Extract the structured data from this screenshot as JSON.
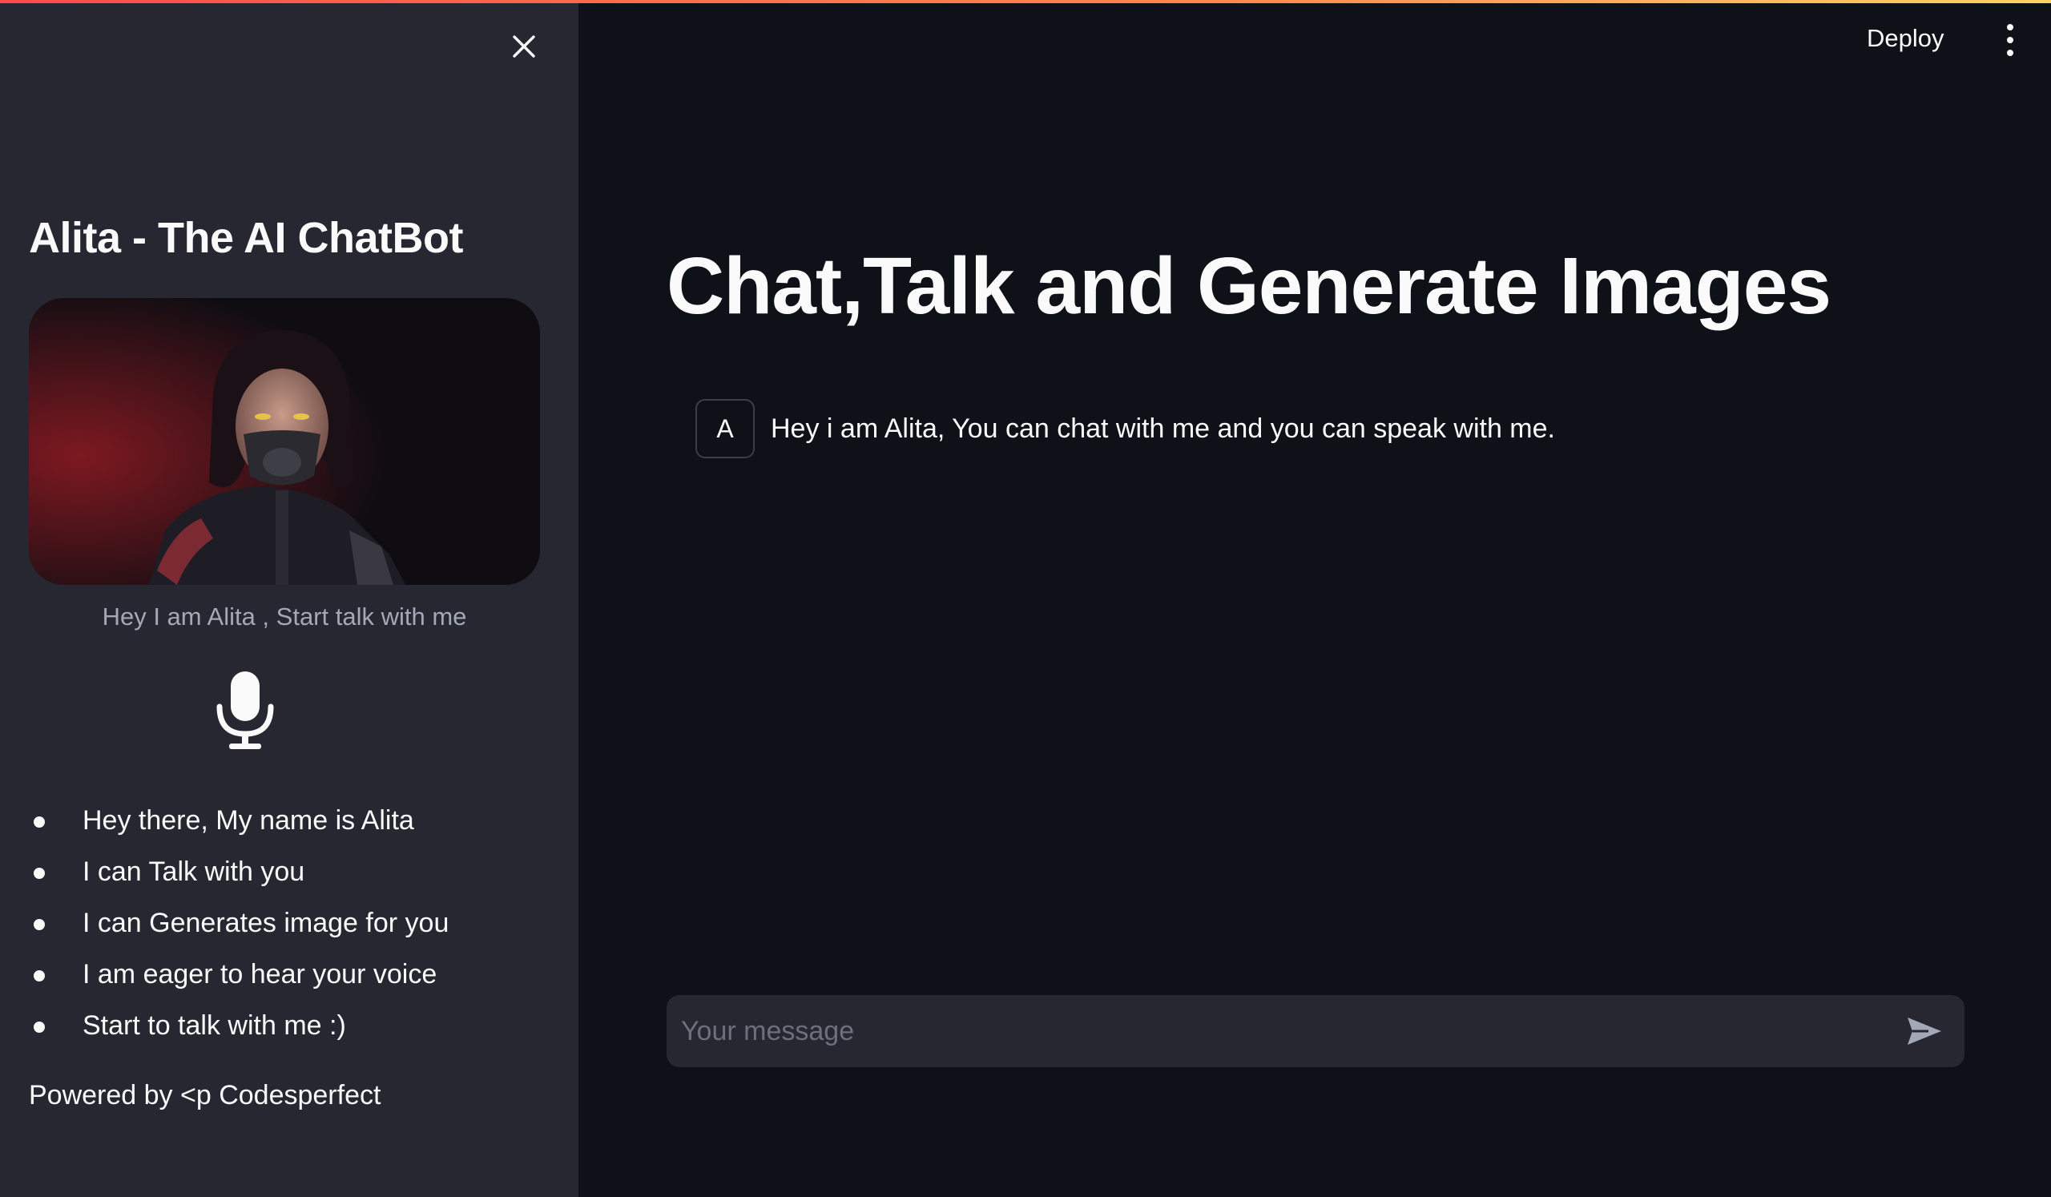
{
  "sidebar": {
    "title": "Alita - The AI ChatBot",
    "image_caption": "Hey I am Alita , Start talk with me",
    "bullets": [
      "Hey there, My name is Alita",
      "I can Talk with you",
      "I can Generates image for you",
      "I am eager to hear your voice",
      "Start to talk with me :)"
    ],
    "footer": "Powered by <p Codesperfect"
  },
  "header": {
    "deploy_label": "Deploy"
  },
  "main": {
    "title": "Chat,Talk and Generate Images",
    "messages": [
      {
        "avatar": "A",
        "text": "Hey i am Alita, You can chat with me and you can speak with me."
      }
    ]
  },
  "chat_input": {
    "placeholder": "Your message",
    "value": ""
  },
  "icons": {
    "close": "close-icon",
    "mic": "microphone-icon",
    "menu": "more-vertical-icon",
    "send": "send-icon"
  },
  "colors": {
    "background": "#0e1117",
    "sidebar": "#262730",
    "text": "#fafafa",
    "accent_gradient_start": "#ff4b4b",
    "accent_gradient_end": "#ffd16a"
  }
}
